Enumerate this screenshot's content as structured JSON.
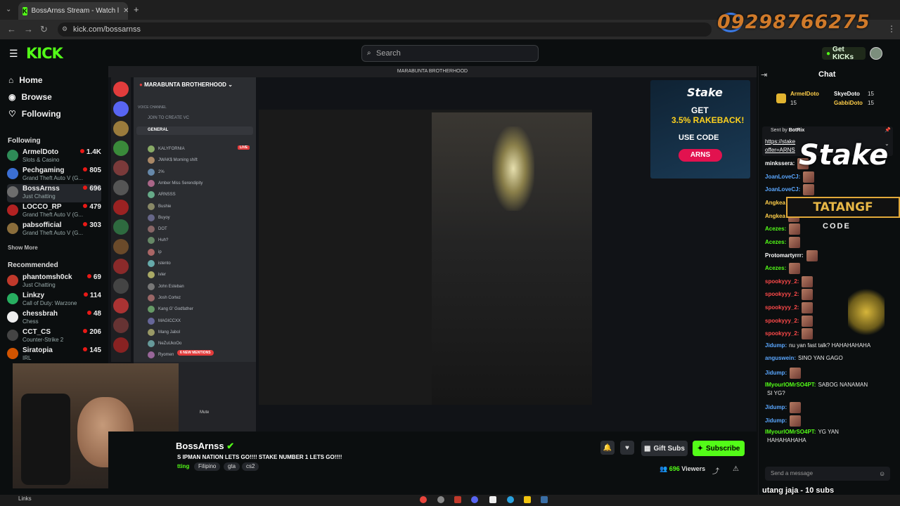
{
  "browser": {
    "tab_title": "BossArnss Stream - Watch l",
    "url": "kick.com/bossarnss"
  },
  "overlay": {
    "phone": "09298766275",
    "stake_logo": "Stake",
    "tatang": "TATANGF",
    "code_label": "CODE",
    "ticker": "utang jaja - 10 subs"
  },
  "header": {
    "logo": "KICK",
    "search_placeholder": "Search",
    "get_kicks": "Get KICKs"
  },
  "sidebar": {
    "nav": [
      {
        "label": "Home",
        "icon": "home-icon"
      },
      {
        "label": "Browse",
        "icon": "compass-icon"
      },
      {
        "label": "Following",
        "icon": "heart-icon"
      }
    ],
    "following_title": "Following",
    "following": [
      {
        "name": "ArmelDoto",
        "category": "Slots & Casino",
        "viewers": "1.4K"
      },
      {
        "name": "Pechgaming",
        "category": "Grand Theft Auto V (G...",
        "viewers": "805"
      },
      {
        "name": "BossArnss",
        "category": "Just Chatting",
        "viewers": "696"
      },
      {
        "name": "LOCCO_RP",
        "category": "Grand Theft Auto V (G...",
        "viewers": "479"
      },
      {
        "name": "pabsofficial",
        "category": "Grand Theft Auto V (G...",
        "viewers": "303"
      }
    ],
    "show_more": "Show More",
    "recommended_title": "Recommended",
    "recommended": [
      {
        "name": "phantomsh0ck",
        "category": "Just Chatting",
        "viewers": "69"
      },
      {
        "name": "Linkzy",
        "category": "Call of Duty: Warzone",
        "viewers": "114"
      },
      {
        "name": "chessbrah",
        "category": "Chess",
        "viewers": "48"
      },
      {
        "name": "CCT_CS",
        "category": "Counter-Strike 2",
        "viewers": "206"
      },
      {
        "name": "Siratopia",
        "category": "IRL",
        "viewers": "145"
      }
    ]
  },
  "discord": {
    "window_title": "MARABUNTA BROTHERHOOD",
    "server_name": "MARABUNTA BROTHERHOOD",
    "voice_channel_label": "VOICE CHANNEL",
    "join_label": "JOIN TO CREATE VC",
    "channel": "GENERAL",
    "live_badge": "LIVE",
    "mention_badge": "6 NEW MENTIONS",
    "mute_label": "Mute",
    "users": [
      "KALYFORNIA",
      "JWAK$ Morning shift",
      "2%",
      "Amber Miss Serendipity",
      "ARNSSS",
      "Bushie",
      "Buyoy",
      "DOT",
      "Huh?",
      "ip",
      "istento",
      "ivler",
      "John Esteban",
      "Josh Cortez",
      "Kang G' Godfather",
      "MAGICCXX",
      "Mang Jabol",
      "NeZuUkoOo",
      "Ryomen"
    ]
  },
  "stake_ad": {
    "brand": "Stake",
    "line1": "GET",
    "line2": "3.5% RAKEBACK!",
    "use_code": "USE CODE",
    "code": "ARNS"
  },
  "stream": {
    "streamer": "BossArnss",
    "title": "S IPMAN NATION LETS GO!!!! STAKE NUMBER 1 LETS GO!!!!",
    "category": "tting",
    "tags": [
      "Filipino",
      "gta",
      "cs2"
    ],
    "gift_subs": "Gift Subs",
    "subscribe": "Subscribe",
    "viewers_count": "696",
    "viewers_label": "Viewers"
  },
  "chat": {
    "title": "Chat",
    "pinned": [
      {
        "user": "ArmelDoto",
        "count": "15"
      },
      {
        "user": "SkyeDoto",
        "count": "15"
      },
      {
        "user": "GabbiDoto",
        "count": "15"
      }
    ],
    "sent_by": "Sent by",
    "bot_name": "BotRix",
    "bot_link": "https://stake",
    "bot_link2": "offer=ARNS",
    "messages": [
      {
        "user": "minkssera:",
        "text": "",
        "color": "#ffffff"
      },
      {
        "user": "JoanLoveCJ:",
        "text": "",
        "color": "#5aa7ff"
      },
      {
        "user": "JoanLoveCJ:",
        "text": "",
        "color": "#5aa7ff"
      },
      {
        "user": "Angkea",
        "text": "",
        "color": "#ffcf4a"
      },
      {
        "user": "Angkea",
        "text": "",
        "color": "#ffcf4a"
      },
      {
        "user": "Acezes:",
        "text": "",
        "color": "#53fc18"
      },
      {
        "user": "Acezes:",
        "text": "",
        "color": "#53fc18"
      },
      {
        "user": "Protomartyrrr:",
        "text": "",
        "color": "#ffffff"
      },
      {
        "user": "Acezes:",
        "text": "",
        "color": "#53fc18"
      },
      {
        "user": "spookyyy_2:",
        "text": "",
        "color": "#ff4a4a"
      },
      {
        "user": "spookyyy_2:",
        "text": "",
        "color": "#ff4a4a"
      },
      {
        "user": "spookyyy_2:",
        "text": "",
        "color": "#ff4a4a"
      },
      {
        "user": "spookyyy_2:",
        "text": "",
        "color": "#ff4a4a"
      },
      {
        "user": "spookyyy_2:",
        "text": "",
        "color": "#ff4a4a"
      },
      {
        "user": "Jidump:",
        "text": "nu yan fast talk? HAHAHAHAHA",
        "color": "#5aa7ff"
      },
      {
        "user": "anguswein:",
        "text": "SINO YAN GAGO",
        "color": "#5aa7ff"
      },
      {
        "user": "Jidump:",
        "text": "",
        "color": "#5aa7ff"
      },
      {
        "user": "IMyourIOMrSO4PT:",
        "text": "SABOG NANAMAN",
        "color": "#53fc18"
      },
      {
        "user": "",
        "text": "SI YG?",
        "color": "#ffffff"
      },
      {
        "user": "Jidump:",
        "text": "",
        "color": "#5aa7ff"
      },
      {
        "user": "Jidump:",
        "text": "",
        "color": "#5aa7ff"
      },
      {
        "user": "IMyourIOMrSO4PT:",
        "text": "YG YAN",
        "color": "#53fc18"
      },
      {
        "user": "",
        "text": "HAHAHAHAHA",
        "color": "#ffffff"
      }
    ],
    "input_placeholder": "Send a message"
  },
  "taskbar": {
    "links_label": "Links"
  }
}
